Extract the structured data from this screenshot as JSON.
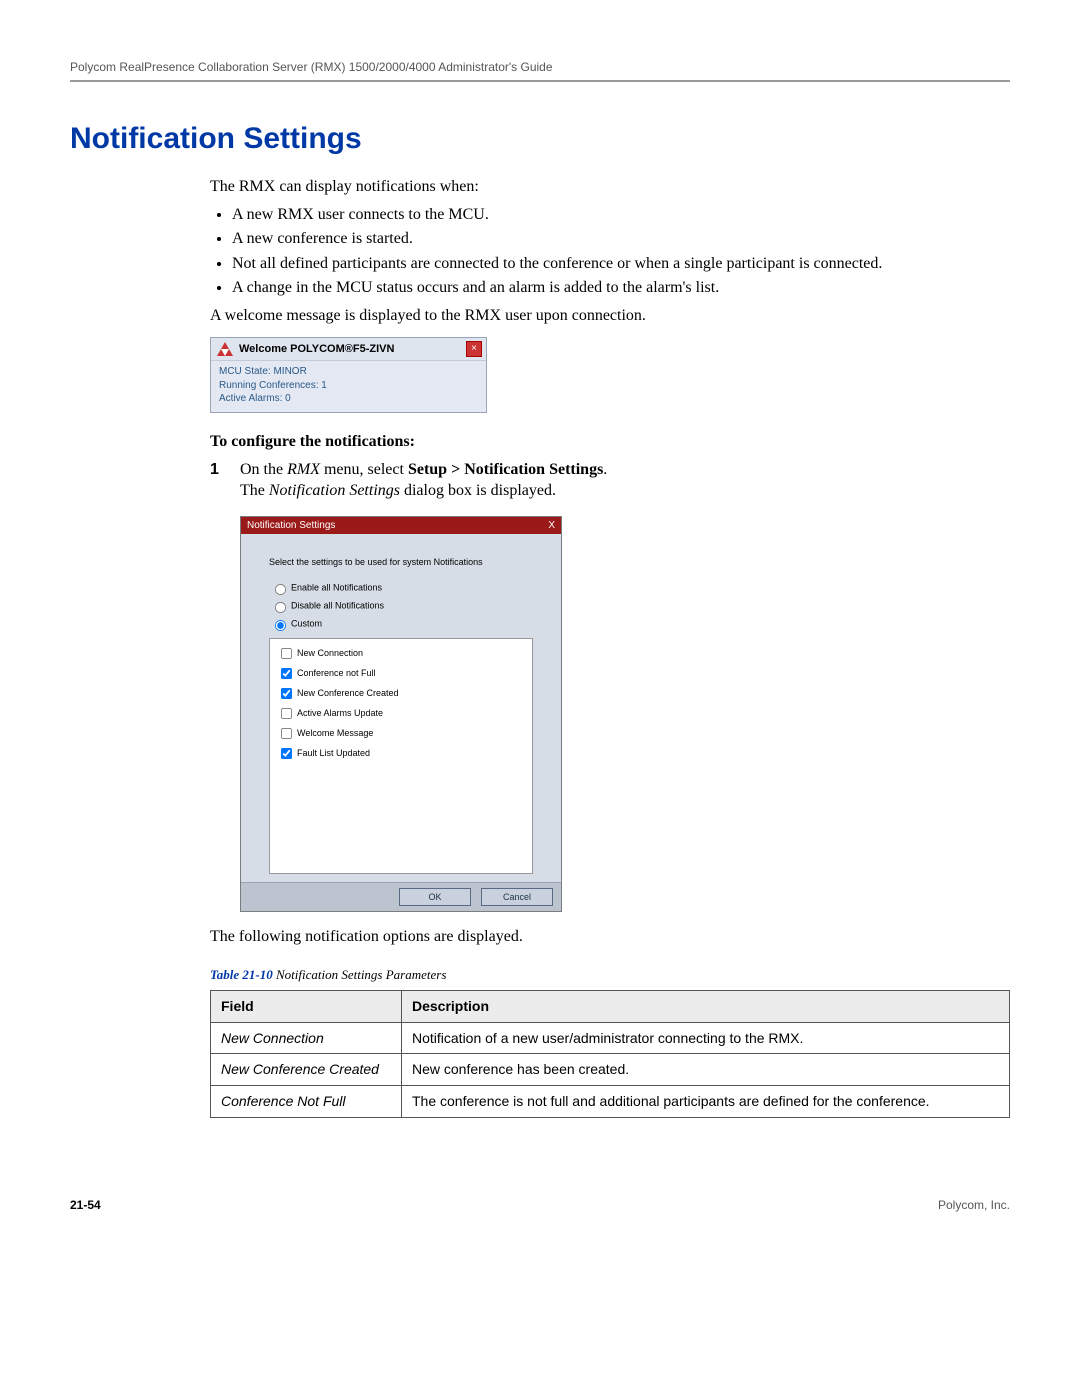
{
  "header": {
    "running_title": "Polycom RealPresence Collaboration Server (RMX) 1500/2000/4000 Administrator's Guide"
  },
  "title": "Notification Settings",
  "intro": {
    "lead": "The RMX can display notifications when:",
    "bullets": [
      "A new RMX user connects to the MCU.",
      "A new conference is started.",
      "Not all defined participants are connected to the conference or when a single participant is connected.",
      "A change in the MCU status occurs and an alarm is added to the alarm's list."
    ],
    "after": "A welcome message is displayed to the RMX user upon connection."
  },
  "welcome_popup": {
    "title": "Welcome POLYCOM®F5-ZIVN",
    "lines": {
      "state": "MCU State: MINOR",
      "conf": "Running Conferences: 1",
      "alarms": "Active Alarms: 0"
    }
  },
  "procedure": {
    "heading": "To configure the notifications:",
    "step1": {
      "num": "1",
      "pre": "On the ",
      "menu_app": "RMX",
      "mid": " menu, select ",
      "menu_path": "Setup > Notification Settings",
      "after": "."
    },
    "result_pre": "The ",
    "result_italic": "Notification Settings",
    "result_after": " dialog box is displayed."
  },
  "dialog": {
    "title": "Notification Settings",
    "close_x": "X",
    "instruction": "Select the settings to be used for system Notifications",
    "radios": {
      "enable": "Enable all Notifications",
      "disable": "Disable all Notifications",
      "custom": "Custom"
    },
    "radio_selected": "custom",
    "checks": [
      {
        "label": "New Connection",
        "checked": false
      },
      {
        "label": "Conference not Full",
        "checked": true
      },
      {
        "label": "New Conference Created",
        "checked": true
      },
      {
        "label": "Active Alarms Update",
        "checked": false
      },
      {
        "label": "Welcome Message",
        "checked": false
      },
      {
        "label": "Fault List Updated",
        "checked": true
      }
    ],
    "buttons": {
      "ok": "OK",
      "cancel": "Cancel"
    }
  },
  "post_dialog": "The following notification options are displayed.",
  "table": {
    "caption_num": "Table 21-10",
    "caption_name": " Notification Settings Parameters",
    "headers": {
      "field": "Field",
      "desc": "Description"
    },
    "rows": [
      {
        "field": "New Connection",
        "desc": "Notification of a new user/administrator connecting to the RMX."
      },
      {
        "field": "New Conference Created",
        "desc": "New conference has been created."
      },
      {
        "field": "Conference Not Full",
        "desc": "The conference is not full and additional participants are defined for the conference."
      }
    ]
  },
  "footer": {
    "page": "21-54",
    "company": "Polycom, Inc."
  }
}
